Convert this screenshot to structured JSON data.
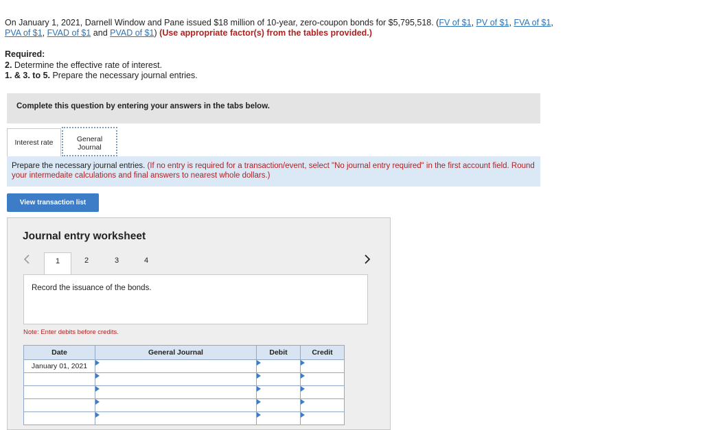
{
  "problem": {
    "text_before": "On January 1, 2021, Darnell Window and Pane issued $18 million of 10-year, zero-coupon bonds for $5,795,518. (",
    "links": [
      "FV of $1",
      "PV of $1",
      "FVA of $1",
      "PVA of $1",
      "FVAD of $1",
      "PVAD of $1"
    ],
    "sep": ", ",
    "and": " and ",
    "close": ") ",
    "instruction": "(Use appropriate factor(s) from the tables provided.)"
  },
  "required": {
    "heading": "Required:",
    "item2_num": "2.",
    "item2_text": " Determine the effective rate of interest.",
    "item3_num": "1. & 3. to 5.",
    "item3_text": " Prepare the necessary journal entries."
  },
  "complete_banner": "Complete this question by entering your answers in the tabs below.",
  "tabs": [
    {
      "label": "Interest rate"
    },
    {
      "label_line1": "General",
      "label_line2": "Journal"
    }
  ],
  "instructions": {
    "main": "Prepare the necessary journal entries. ",
    "note": "(If no entry is required for a transaction/event, select \"No journal entry required\" in the first account field. Round your intermedaite calculations and final answers to nearest whole dollars.)"
  },
  "view_transaction_button": "View transaction list",
  "worksheet": {
    "title": "Journal entry worksheet",
    "pages": [
      "1",
      "2",
      "3",
      "4"
    ],
    "active_page": "1",
    "prev_icon": "chevron-left-icon",
    "next_icon": "chevron-right-icon",
    "record_text": "Record the issuance of the bonds.",
    "note": "Note: Enter debits before credits.",
    "columns": [
      "Date",
      "General Journal",
      "Debit",
      "Credit"
    ],
    "rows": [
      {
        "date": "January 01, 2021",
        "account": "",
        "debit": "",
        "credit": ""
      },
      {
        "date": "",
        "account": "",
        "debit": "",
        "credit": ""
      },
      {
        "date": "",
        "account": "",
        "debit": "",
        "credit": ""
      },
      {
        "date": "",
        "account": "",
        "debit": "",
        "credit": ""
      },
      {
        "date": "",
        "account": "",
        "debit": "",
        "credit": ""
      }
    ]
  },
  "colors": {
    "link": "#2a73b8",
    "alert_red": "#b22020",
    "button_blue": "#3d7cc6",
    "instruction_bg": "#dbe9f7",
    "banner_bg": "#e4e4e4"
  }
}
